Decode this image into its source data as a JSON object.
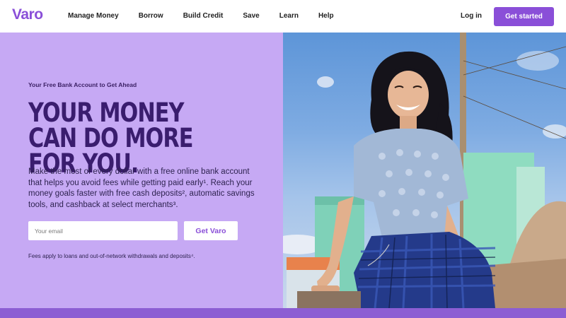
{
  "nav": {
    "logo": "Varo",
    "links": [
      "Manage Money",
      "Borrow",
      "Build Credit",
      "Save",
      "Learn",
      "Help"
    ],
    "login": "Log in",
    "cta": "Get started"
  },
  "hero": {
    "kicker": "Your Free Bank Account to Get Ahead",
    "headline": "YOUR MONEY CAN DO MORE FOR YOU.",
    "body": "Make the most of every dollar with a free online bank account that helps you avoid fees while getting paid early¹. Reach your money goals faster with free cash deposits², automatic savings tools, and cashback at select merchants³.",
    "email_placeholder": "Your email",
    "submit": "Get Varo",
    "disclaimer": "Fees apply to loans and out-of-network withdrawals and deposits⁴."
  },
  "colors": {
    "brand": "#8a4fd8",
    "hero_bg": "#c6a9f4",
    "headline": "#3a1d6e"
  }
}
